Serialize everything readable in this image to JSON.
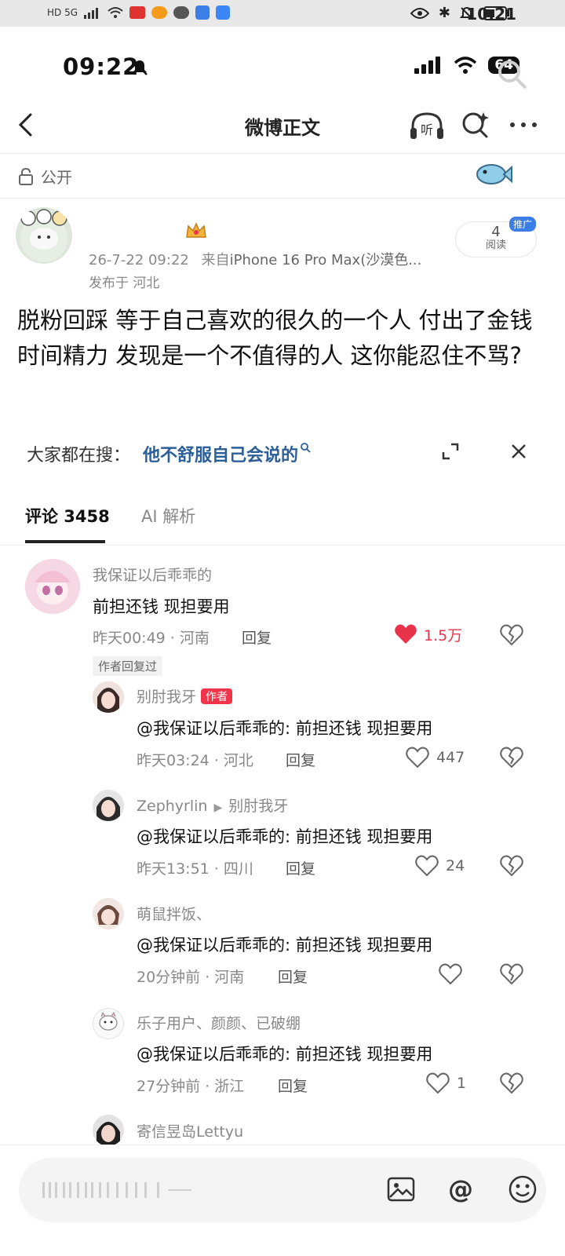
{
  "outer_status": {
    "left": "HD 5G",
    "time": "10:21"
  },
  "inner_status": {
    "time": "09:22",
    "battery": "64"
  },
  "nav": {
    "title": "微博正文"
  },
  "visibility": {
    "label": "公开"
  },
  "post": {
    "timestamp": "26-7-22 09:22",
    "source_prefix": "来自",
    "source": "iPhone 16 Pro Max(沙漠色...",
    "location": "发布于 河北",
    "read_count": "4",
    "read_label": "阅读",
    "promo_badge": "推广",
    "body": "脱粉回踩 等于自己喜欢的很久的一个人 付出了金钱时间精力 发现是一个不值得的人 这你能忍住不骂?"
  },
  "hot_search": {
    "label": "大家都在搜：",
    "query": "他不舒服自己会说的"
  },
  "tabs": {
    "comments": "评论 3458",
    "ai": "AI 解析"
  },
  "comments": [
    {
      "name": "我保证以后乖乖的",
      "text": "前担还钱 现担要用",
      "meta": "昨天00:49 · 河南",
      "reply": "回复",
      "likes": "1.5万",
      "liked": true,
      "tag": "作者回复过"
    },
    {
      "name": "别肘我牙",
      "badge": "作者",
      "text": "@我保证以后乖乖的: 前担还钱 现担要用",
      "meta": "昨天03:24 · 河北",
      "reply": "回复",
      "likes": "447"
    },
    {
      "name": "Zephyrlin",
      "reply_to": "别肘我牙",
      "text": "@我保证以后乖乖的: 前担还钱 现担要用",
      "meta": "昨天13:51 · 四川",
      "reply": "回复",
      "likes": "24"
    },
    {
      "name": "萌鼠拌饭、",
      "text": "@我保证以后乖乖的: 前担还钱 现担要用",
      "meta": "20分钟前 · 河南",
      "reply": "回复",
      "likes": ""
    },
    {
      "name": "乐子用户、颜颜、已破绷",
      "text": "@我保证以后乖乖的: 前担还钱 现担要用",
      "meta": "27分钟前 · 浙江",
      "reply": "回复",
      "likes": "1"
    },
    {
      "name": "寄信昱岛Lettyu"
    }
  ],
  "colors": {
    "accent_red": "#f0344a",
    "link_blue": "#2c5e98",
    "like_red": "#e8334b"
  }
}
